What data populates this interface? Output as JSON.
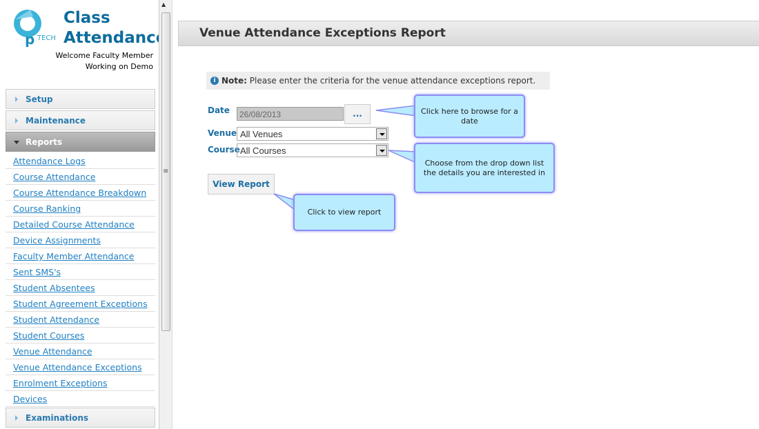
{
  "app": {
    "logo_text": "iTECH",
    "title_line1": "Class",
    "title_line2": "Attendance",
    "welcome": "Welcome Faculty Member",
    "working_on": "Working on Demo"
  },
  "sidebar": {
    "sections": [
      {
        "label": "Setup"
      },
      {
        "label": "Maintenance"
      },
      {
        "label": "Reports"
      },
      {
        "label": "Examinations"
      }
    ],
    "report_links": [
      "Attendance Logs",
      "Course Attendance",
      "Course Attendance Breakdown",
      "Course Ranking",
      "Detailed Course Attendance",
      "Device Assignments",
      "Faculty Member Attendance",
      "Sent SMS's",
      "Student Absentees",
      "Student Agreement Exceptions",
      "Student Attendance",
      "Student Courses",
      "Venue Attendance",
      "Venue Attendance Exceptions",
      "Enrolment Exceptions",
      "Devices"
    ]
  },
  "main": {
    "title": "Venue Attendance Exceptions Report",
    "note_label": "Note:",
    "note_text": " Please enter the criteria for the venue attendance exceptions report.",
    "date_label": "Date",
    "date_value": "26/08/2013",
    "browse_label": "...",
    "venue_label": "Venue",
    "venue_value": "All Venues",
    "course_label": "Course",
    "course_value": "All Courses",
    "view_report": "View Report"
  },
  "callouts": {
    "date": "Click here to browse for a date",
    "dropdown": "Choose from the drop down list the details you are interested in",
    "view": "Click to view report"
  },
  "colors": {
    "accent": "#1c6ea4",
    "callout_bg": "#b9ecff",
    "callout_border": "#8c8cf2"
  }
}
